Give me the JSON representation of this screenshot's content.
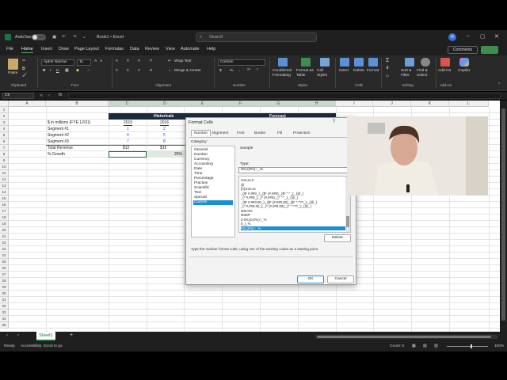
{
  "titlebar": {
    "autosave_label": "AutoSave",
    "autosave_state": "Off",
    "file_name": "Book1 • Excel",
    "search_placeholder": "Search",
    "avatar_initial": "R"
  },
  "menu": {
    "items": [
      "File",
      "Home",
      "Insert",
      "Draw",
      "Page Layout",
      "Formulas",
      "Data",
      "Review",
      "View",
      "Automate",
      "Help"
    ],
    "active": "Home",
    "comments_label": "Comments"
  },
  "ribbon": {
    "paste_label": "Paste",
    "groups": {
      "clipboard": "Clipboard",
      "font": "Font",
      "alignment": "Alignment",
      "number": "Number",
      "styles": "Styles",
      "cells": "Cells",
      "editing": "Editing",
      "addins": "Add-ins"
    },
    "font_name": "Aptos Narrow",
    "font_size": "11",
    "wrap_text": "Wrap Text",
    "merge_center": "Merge & Center",
    "number_format": "Custom",
    "conditional_formatting": "Conditional Formatting",
    "format_as_table": "Format as Table",
    "cell_styles": "Cell Styles",
    "insert": "Insert",
    "delete": "Delete",
    "format": "Format",
    "sort_filter": "Sort & Filter",
    "find_select": "Find & Select",
    "addins": "Add-ins",
    "copilot": "Copilot",
    "accent_color": "#3e8d4f"
  },
  "formula_bar": {
    "name_box": "C8",
    "fx": "fx",
    "content": ""
  },
  "grid": {
    "columns": [
      "A",
      "B",
      "C",
      "D",
      "E",
      "F",
      "G",
      "H",
      "I",
      "J",
      "K",
      "L"
    ],
    "selected_columns": [
      "C",
      "D",
      "E",
      "F",
      "G",
      "H"
    ],
    "rows": [
      "1",
      "2",
      "3",
      "4",
      "5",
      "6",
      "7",
      "8",
      "9",
      "10",
      "11",
      "12",
      "13",
      "14",
      "15",
      "16",
      "17",
      "18",
      "19",
      "20",
      "21",
      "22",
      "23",
      "24",
      "25",
      "26",
      "27",
      "28",
      "29",
      "30",
      "31",
      "32",
      "33",
      "34",
      "35"
    ],
    "header_historicals": "Historicals",
    "header_forecast": "Forecast",
    "label_units": "$ in millions (FYE 12/31)",
    "year_2015": "2015",
    "year_2016": "2016",
    "segment_1": "Segment #1",
    "segment_2": "Segment #2",
    "segment_3": "Segment #3",
    "seg1_2015": "1",
    "seg1_2016": "2",
    "seg2_2015": "4",
    "seg2_2016": "5",
    "seg3_2015": "7",
    "seg3_2016": "8",
    "total_revenue": "Total Revenue",
    "total_2015": "$12",
    "total_2016": "$15",
    "growth_label": "% Growth",
    "growth_2016": "25%"
  },
  "dialog": {
    "title": "Format Cells",
    "close": "?",
    "tabs": [
      "Number",
      "Alignment",
      "Font",
      "Border",
      "Fill",
      "Protection"
    ],
    "active_tab": "Number",
    "category_label": "Category:",
    "categories": [
      "General",
      "Number",
      "Currency",
      "Accounting",
      "Date",
      "Time",
      "Percentage",
      "Fraction",
      "Scientific",
      "Text",
      "Special",
      "Custom"
    ],
    "selected_category": "Custom",
    "sample_label": "Sample",
    "type_label": "Type:",
    "type_value": "0%;(0%);-_%",
    "formats": [
      "mm:ss.0",
      "@",
      "[h]:mm:ss",
      "_($* #,##0_);_($* (#,##0);_($* \"-\"_);_(@_)",
      "_(* #,##0_);_(* (#,##0);_(* \"-\"_);_(@_)",
      "_($* #,##0.00_);_($* (#,##0.00);_($* \"-\"??_);_(@_)",
      "_(* #,##0.00_);_(* (#,##0.00);_(* \"-\"??_);_(@_)",
      "000.0%",
      "0000F",
      "0.0%;(0.0%);-_%",
      "0_)_%",
      "0%;(0%);-_%"
    ],
    "selected_format": "0%;(0%);-_%",
    "delete_label": "Delete",
    "hint": "Type the number format code, using one of the existing codes as a starting point.",
    "ok_label": "OK",
    "cancel_label": "Cancel"
  },
  "sheets": {
    "tabs": [
      "Sheet1"
    ],
    "add_label": "+"
  },
  "status": {
    "ready": "Ready",
    "accessibility": "Accessibility: Good to go",
    "count": "Count: 5",
    "zoom": "100%"
  }
}
